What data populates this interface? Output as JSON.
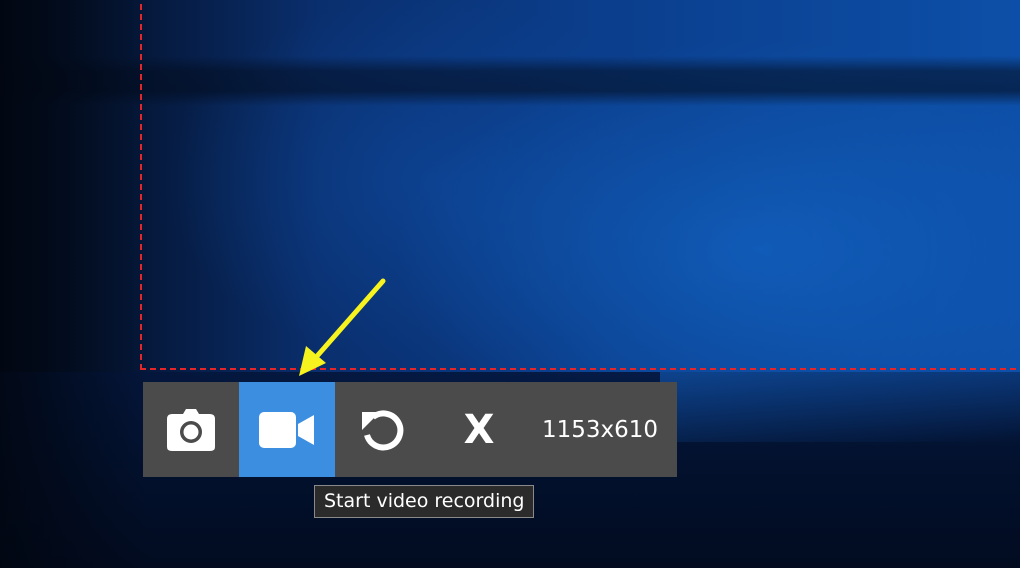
{
  "toolbar": {
    "buttons": [
      {
        "id": "screenshot",
        "icon": "camera-icon",
        "active": false
      },
      {
        "id": "video",
        "icon": "video-camera-icon",
        "active": true
      },
      {
        "id": "redo",
        "icon": "refresh-icon",
        "active": false
      },
      {
        "id": "close",
        "icon": "close-icon",
        "label": "X",
        "active": false
      }
    ],
    "dimensions": "1153x610"
  },
  "tooltip": {
    "text": "Start video recording"
  },
  "colors": {
    "toolbar_bg": "#4b4b4b",
    "active_button": "#3c8fe0",
    "selection_border": "#e3262a",
    "annotation_arrow": "#f7f31e",
    "tooltip_bg": "#2b2b2b"
  }
}
